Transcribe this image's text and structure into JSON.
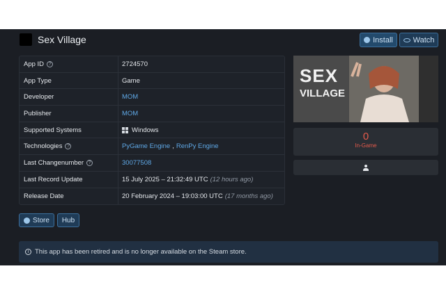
{
  "header": {
    "title": "Sex Village",
    "install_label": "Install",
    "watch_label": "Watch"
  },
  "info_table": {
    "rows": [
      {
        "key": "App ID",
        "value": "2724570"
      },
      {
        "key": "App Type",
        "value": "Game"
      },
      {
        "key": "Developer",
        "value": "MOM"
      },
      {
        "key": "Publisher",
        "value": "MOM"
      },
      {
        "key": "Supported Systems",
        "value": "Windows"
      },
      {
        "key": "Technologies",
        "value_a": "PyGame Engine",
        "sep": ",",
        "value_b": "RenPy Engine"
      },
      {
        "key": "Last Changenumber",
        "value": "30077508"
      },
      {
        "key": "Last Record Update",
        "value": "15 July 2025 – 21:32:49 UTC",
        "ago": "(12 hours ago)"
      },
      {
        "key": "Release Date",
        "value": "20 February 2024 – 19:03:00 UTC",
        "ago": "(17 months ago)"
      }
    ]
  },
  "hero": {
    "line1": "SEX",
    "line2": "VILLAGE"
  },
  "stats": {
    "in_game_count": "0",
    "in_game_label": "In-Game"
  },
  "buttons": {
    "store_label": "Store",
    "hub_label": "Hub"
  },
  "notice": {
    "text": "This app has been retired and is no longer available on the Steam store."
  },
  "colors": {
    "background": "#1b1e24",
    "accent_link": "#5fa8e6",
    "ingame_red": "#e35a4b",
    "notice_bg": "#213042"
  }
}
